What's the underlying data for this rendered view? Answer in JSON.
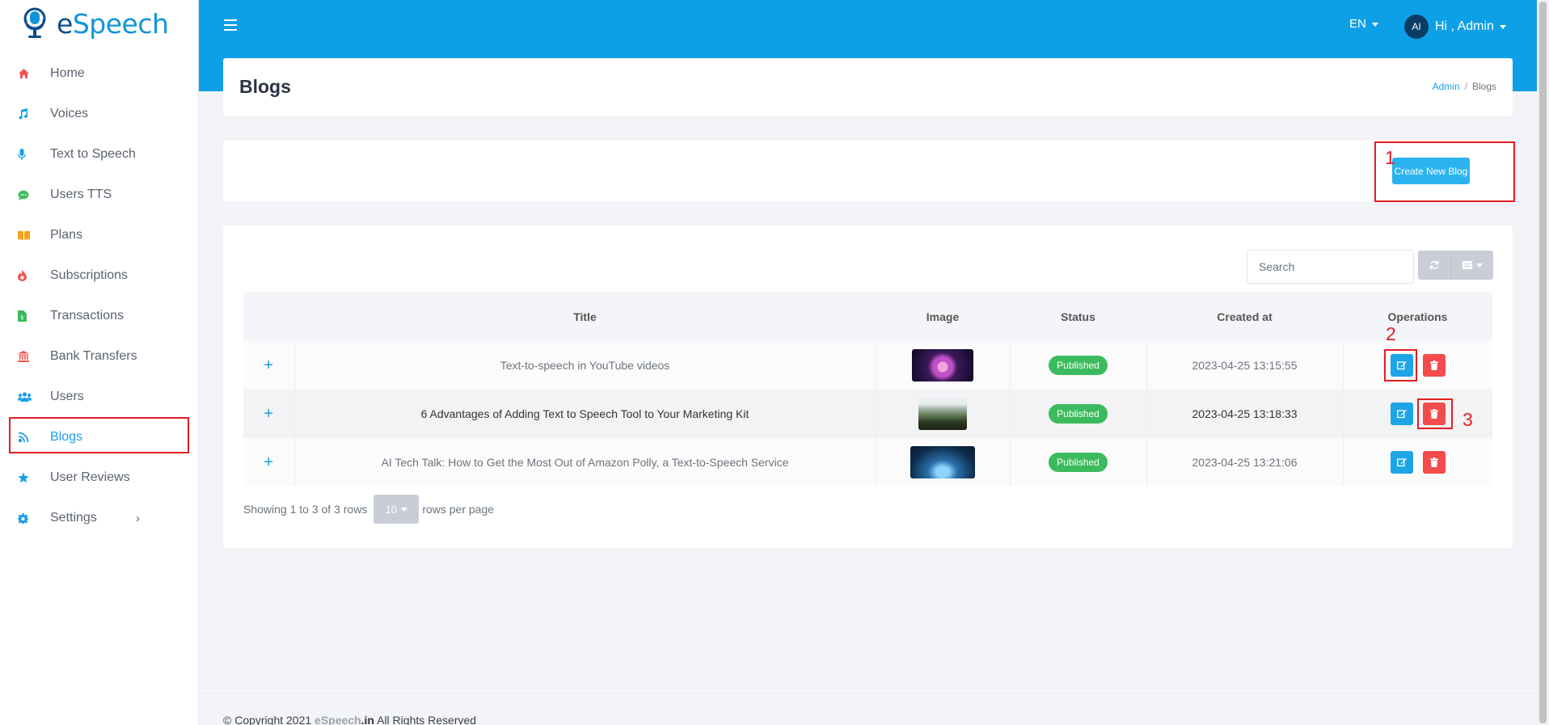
{
  "brand": {
    "name_part1": "e",
    "name_part2": "Speech"
  },
  "sidebar": {
    "items": [
      {
        "label": "Home",
        "icon": "home-icon",
        "color": "#f05454"
      },
      {
        "label": "Voices",
        "icon": "music-icon",
        "color": "#1a9ee8"
      },
      {
        "label": "Text to Speech",
        "icon": "microphone-icon",
        "color": "#1a9ee8"
      },
      {
        "label": "Users TTS",
        "icon": "chat-icon",
        "color": "#3cbb5e"
      },
      {
        "label": "Plans",
        "icon": "book-icon",
        "color": "#f3a21b"
      },
      {
        "label": "Subscriptions",
        "icon": "fire-icon",
        "color": "#f05454"
      },
      {
        "label": "Transactions",
        "icon": "receipt-icon",
        "color": "#3cbb5e"
      },
      {
        "label": "Bank Transfers",
        "icon": "bank-icon",
        "color": "#f05454"
      },
      {
        "label": "Users",
        "icon": "users-icon",
        "color": "#1a9ee8"
      },
      {
        "label": "Blogs",
        "icon": "blog-icon",
        "color": "#1a9ee8"
      },
      {
        "label": "User Reviews",
        "icon": "star-icon",
        "color": "#1a9ee8"
      },
      {
        "label": "Settings",
        "icon": "gear-icon",
        "color": "#1a9ee8"
      }
    ],
    "active": "Blogs"
  },
  "topbar": {
    "language": "EN",
    "avatar_initials": "AI",
    "greeting": "Hi , Admin"
  },
  "page": {
    "title": "Blogs",
    "breadcrumb": [
      "Admin",
      "/",
      "Blogs"
    ]
  },
  "actions": {
    "create_label": "Create New Blog"
  },
  "search": {
    "placeholder": "Search"
  },
  "table": {
    "columns": [
      "Title",
      "Image",
      "Status",
      "Created at",
      "Operations"
    ],
    "rows": [
      {
        "expand": "+",
        "title": "Text-to-speech in YouTube videos",
        "image": "microphone-thumbnail",
        "status": "Published",
        "created_at": "2023-04-25 13:15:55"
      },
      {
        "expand": "+",
        "title": "6 Advantages of Adding Text to Speech Tool to Your Marketing Kit",
        "image": "trees-thumbnail",
        "status": "Published",
        "created_at": "2023-04-25 13:18:33"
      },
      {
        "expand": "+",
        "title": "AI Tech Talk: How to Get the Most Out of Amazon Polly, a Text-to-Speech Service",
        "image": "network-thumbnail",
        "status": "Published",
        "created_at": "2023-04-25 13:21:06"
      }
    ]
  },
  "pagination": {
    "showing": "Showing 1 to 3 of 3 rows",
    "page_size": "10",
    "suffix": "rows per page"
  },
  "footer": {
    "copyright": "© Copyright 2021",
    "brand": "eSpeech",
    "domain": ".in",
    "rights": "All Rights Reserved"
  },
  "annotations": [
    "1",
    "2",
    "3"
  ],
  "colors": {
    "primary": "#0ea0e6",
    "success": "#3cbb5e",
    "danger": "#f24c4c",
    "annotation": "#e31d23"
  }
}
